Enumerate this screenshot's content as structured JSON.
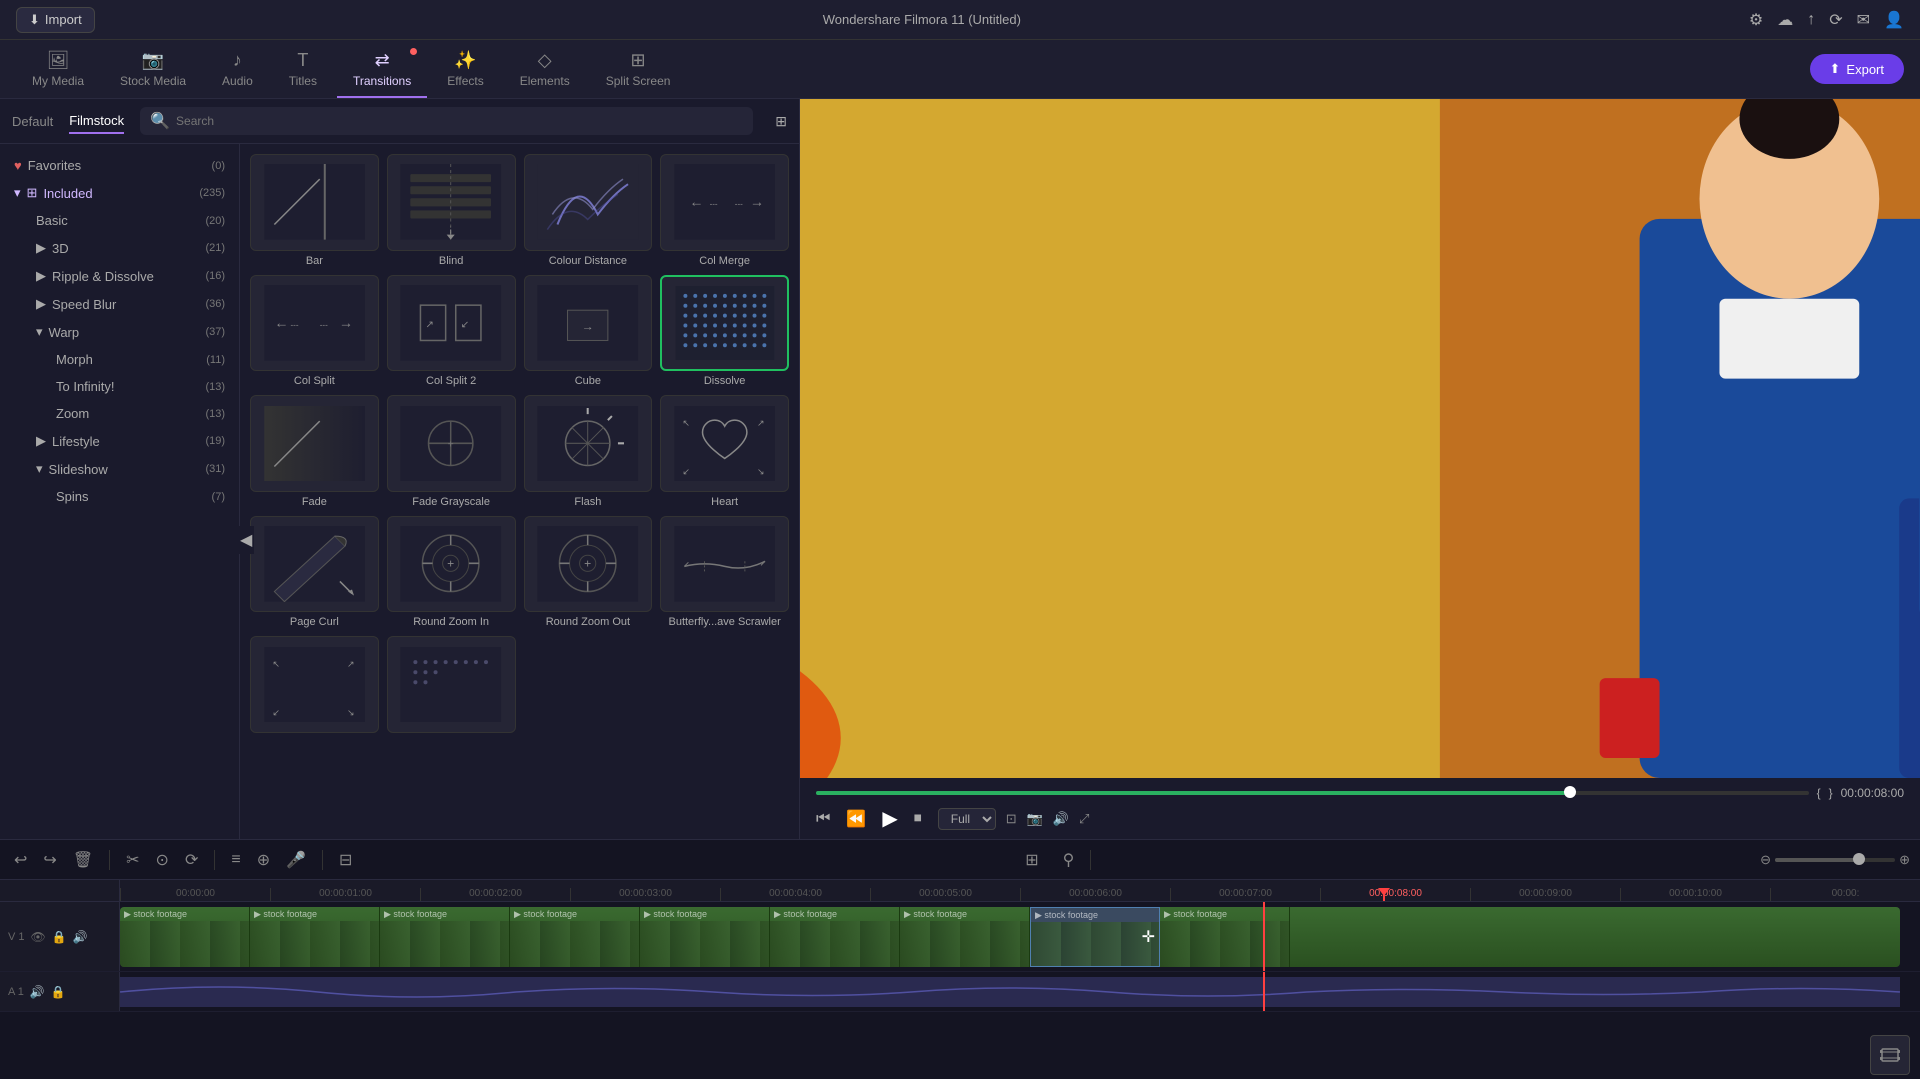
{
  "app": {
    "title": "Wondershare Filmora 11 (Untitled)",
    "import_label": "Import",
    "export_label": "Export"
  },
  "nav": {
    "tabs": [
      {
        "id": "my-media",
        "label": "My Media",
        "icon": "🖼"
      },
      {
        "id": "stock-media",
        "label": "Stock Media",
        "icon": "📷"
      },
      {
        "id": "audio",
        "label": "Audio",
        "icon": "🎵"
      },
      {
        "id": "titles",
        "label": "Titles",
        "icon": "T"
      },
      {
        "id": "transitions",
        "label": "Transitions",
        "icon": "⇄",
        "active": true
      },
      {
        "id": "effects",
        "label": "Effects",
        "icon": "✨"
      },
      {
        "id": "elements",
        "label": "Elements",
        "icon": "◇"
      },
      {
        "id": "split-screen",
        "label": "Split Screen",
        "icon": "⊞"
      }
    ]
  },
  "panel": {
    "tabs": [
      {
        "label": "Default",
        "active": false
      },
      {
        "label": "Filmstock",
        "active": true
      }
    ],
    "search_placeholder": "Search"
  },
  "sidebar": {
    "items": [
      {
        "id": "favorites",
        "label": "Favorites",
        "count": "(0)",
        "icon": "heart",
        "expanded": false,
        "depth": 0
      },
      {
        "id": "included",
        "label": "Included",
        "count": "(235)",
        "icon": "grid",
        "expanded": true,
        "depth": 0
      },
      {
        "id": "basic",
        "label": "Basic",
        "count": "(20)",
        "depth": 1
      },
      {
        "id": "3d",
        "label": "3D",
        "count": "(21)",
        "depth": 1,
        "expandable": true
      },
      {
        "id": "ripple",
        "label": "Ripple & Dissolve",
        "count": "(16)",
        "depth": 1,
        "expandable": true
      },
      {
        "id": "speed-blur",
        "label": "Speed Blur",
        "count": "(36)",
        "depth": 1,
        "expandable": true
      },
      {
        "id": "warp",
        "label": "Warp",
        "count": "(37)",
        "depth": 1,
        "expanded": true
      },
      {
        "id": "morph",
        "label": "Morph",
        "count": "(11)",
        "depth": 2
      },
      {
        "id": "to-infinity",
        "label": "To Infinity!",
        "count": "(13)",
        "depth": 2
      },
      {
        "id": "zoom",
        "label": "Zoom",
        "count": "(13)",
        "depth": 2
      },
      {
        "id": "lifestyle",
        "label": "Lifestyle",
        "count": "(19)",
        "depth": 1,
        "expandable": true
      },
      {
        "id": "slideshow",
        "label": "Slideshow",
        "count": "(31)",
        "depth": 1,
        "expanded": true
      },
      {
        "id": "spins",
        "label": "Spins",
        "count": "(7)",
        "depth": 2
      }
    ]
  },
  "transitions": [
    {
      "id": "bar",
      "label": "Bar",
      "type": "bar"
    },
    {
      "id": "blind",
      "label": "Blind",
      "type": "blind"
    },
    {
      "id": "colour-distance",
      "label": "Colour Distance",
      "type": "colour-distance"
    },
    {
      "id": "col-merge",
      "label": "Col Merge",
      "type": "col-merge"
    },
    {
      "id": "col-split",
      "label": "Col Split",
      "type": "col-split"
    },
    {
      "id": "col-split-2",
      "label": "Col Split 2",
      "type": "col-split-2"
    },
    {
      "id": "cube",
      "label": "Cube",
      "type": "cube"
    },
    {
      "id": "dissolve",
      "label": "Dissolve",
      "type": "dissolve",
      "selected": true
    },
    {
      "id": "fade",
      "label": "Fade",
      "type": "fade"
    },
    {
      "id": "fade-grayscale",
      "label": "Fade Grayscale",
      "type": "fade-grayscale"
    },
    {
      "id": "flash",
      "label": "Flash",
      "type": "flash"
    },
    {
      "id": "heart",
      "label": "Heart",
      "type": "heart"
    },
    {
      "id": "page-curl",
      "label": "Page Curl",
      "type": "page-curl"
    },
    {
      "id": "round-zoom-in",
      "label": "Round Zoom In",
      "type": "round-zoom-in"
    },
    {
      "id": "round-zoom-out",
      "label": "Round Zoom Out",
      "type": "round-zoom-out"
    },
    {
      "id": "butterfly-scrawler",
      "label": "Butterfly...ave Scrawler",
      "type": "butterfly"
    }
  ],
  "preview": {
    "time_current": "00:00:08:00",
    "time_bracket_left": "{",
    "time_bracket_right": "}",
    "progress_percent": 76,
    "quality": "Full"
  },
  "timeline": {
    "ruler_marks": [
      "00:00:00",
      "00:00:01:00",
      "00:00:02:00",
      "00:00:03:00",
      "00:00:04:00",
      "00:00:05:00",
      "00:00:06:00",
      "00:00:07:00",
      "00:00:08:00",
      "00:00:09:00",
      "00:00:10:00",
      "00:00:"
    ],
    "playhead_position_percent": 63,
    "tracks": [
      {
        "id": "v1",
        "type": "video",
        "track_num": "V1",
        "clips_count": 9
      },
      {
        "id": "a1",
        "type": "audio",
        "track_num": "A1"
      }
    ]
  },
  "icons": {
    "import": "⬇",
    "export": "⬆",
    "play": "▶",
    "pause": "⏸",
    "stop": "⏹",
    "step_back": "⏮",
    "step_fwd": "⏭",
    "undo": "↩",
    "redo": "↪",
    "cut": "✂",
    "search": "🔍",
    "grid": "⊞",
    "settings": "⚙",
    "sun": "☀",
    "cloud": "☁",
    "bell": "🔔",
    "music": "♪",
    "user": "👤",
    "download": "⬇",
    "trash": "🗑",
    "snap": "🔗",
    "camera": "📷",
    "micro": "🎤",
    "zoom_in": "⊕",
    "zoom_out": "⊖",
    "nav_arrow": "◀",
    "eye": "👁",
    "lock": "🔒",
    "audio_on": "🔊"
  }
}
